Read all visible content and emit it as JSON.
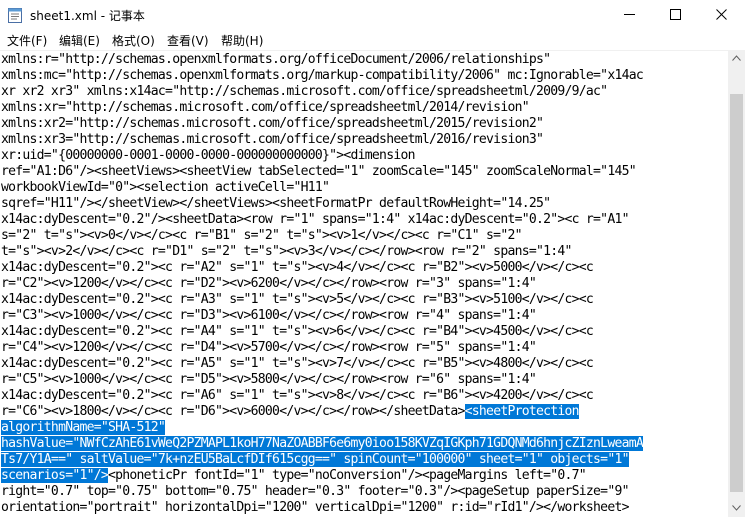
{
  "window": {
    "title": "sheet1.xml - 记事本",
    "controls": {
      "minimize": "minimize",
      "maximize": "maximize",
      "close": "close"
    }
  },
  "menu": {
    "items": [
      {
        "label": "文件(F)"
      },
      {
        "label": "编辑(E)"
      },
      {
        "label": "格式(O)"
      },
      {
        "label": "查看(V)"
      },
      {
        "label": "帮助(H)"
      }
    ]
  },
  "editor": {
    "lines": [
      [
        {
          "t": "xmlns:r=\"http://schemas.openxmlformats.org/officeDocument/2006/relationships\""
        }
      ],
      [
        {
          "t": "xmlns:mc=\"http://schemas.openxmlformats.org/markup-compatibility/2006\" mc:Ignorable=\"x14ac"
        }
      ],
      [
        {
          "t": "xr xr2 xr3\" xmlns:x14ac=\"http://schemas.microsoft.com/office/spreadsheetml/2009/9/ac\""
        }
      ],
      [
        {
          "t": "xmlns:xr=\"http://schemas.microsoft.com/office/spreadsheetml/2014/revision\""
        }
      ],
      [
        {
          "t": "xmlns:xr2=\"http://schemas.microsoft.com/office/spreadsheetml/2015/revision2\""
        }
      ],
      [
        {
          "t": "xmlns:xr3=\"http://schemas.microsoft.com/office/spreadsheetml/2016/revision3\""
        }
      ],
      [
        {
          "t": "xr:uid=\"{00000000-0001-0000-0000-000000000000}\"><dimension"
        }
      ],
      [
        {
          "t": "ref=\"A1:D6\"/><sheetViews><sheetView tabSelected=\"1\" zoomScale=\"145\" zoomScaleNormal=\"145\""
        }
      ],
      [
        {
          "t": "workbookViewId=\"0\"><selection activeCell=\"H11\""
        }
      ],
      [
        {
          "t": "sqref=\"H11\"/></sheetView></sheetViews><sheetFormatPr defaultRowHeight=\"14.25\""
        }
      ],
      [
        {
          "t": "x14ac:dyDescent=\"0.2\"/><sheetData><row r=\"1\" spans=\"1:4\" x14ac:dyDescent=\"0.2\"><c r=\"A1\""
        }
      ],
      [
        {
          "t": "s=\"2\" t=\"s\"><v>0</v></c><c r=\"B1\" s=\"2\" t=\"s\"><v>1</v></c><c r=\"C1\" s=\"2\""
        }
      ],
      [
        {
          "t": "t=\"s\"><v>2</v></c><c r=\"D1\" s=\"2\" t=\"s\"><v>3</v></c></row><row r=\"2\" spans=\"1:4\""
        }
      ],
      [
        {
          "t": "x14ac:dyDescent=\"0.2\"><c r=\"A2\" s=\"1\" t=\"s\"><v>4</v></c><c r=\"B2\"><v>5000</v></c><c"
        }
      ],
      [
        {
          "t": "r=\"C2\"><v>1200</v></c><c r=\"D2\"><v>6200</v></c></row><row r=\"3\" spans=\"1:4\""
        }
      ],
      [
        {
          "t": "x14ac:dyDescent=\"0.2\"><c r=\"A3\" s=\"1\" t=\"s\"><v>5</v></c><c r=\"B3\"><v>5100</v></c><c"
        }
      ],
      [
        {
          "t": "r=\"C3\"><v>1000</v></c><c r=\"D3\"><v>6100</v></c></row><row r=\"4\" spans=\"1:4\""
        }
      ],
      [
        {
          "t": "x14ac:dyDescent=\"0.2\"><c r=\"A4\" s=\"1\" t=\"s\"><v>6</v></c><c r=\"B4\"><v>4500</v></c><c"
        }
      ],
      [
        {
          "t": "r=\"C4\"><v>1200</v></c><c r=\"D4\"><v>5700</v></c></row><row r=\"5\" spans=\"1:4\""
        }
      ],
      [
        {
          "t": "x14ac:dyDescent=\"0.2\"><c r=\"A5\" s=\"1\" t=\"s\"><v>7</v></c><c r=\"B5\"><v>4800</v></c><c"
        }
      ],
      [
        {
          "t": "r=\"C5\"><v>1000</v></c><c r=\"D5\"><v>5800</v></c></row><row r=\"6\" spans=\"1:4\""
        }
      ],
      [
        {
          "t": "x14ac:dyDescent=\"0.2\"><c r=\"A6\" s=\"1\" t=\"s\"><v>8</v></c><c r=\"B6\"><v>4200</v></c><c"
        }
      ],
      [
        {
          "t": "r=\"C6\"><v>1800</v></c><c r=\"D6\"><v>6000</v></c></row></sheetData>"
        },
        {
          "t": "<sheetProtection",
          "hl": true
        }
      ],
      [
        {
          "t": "algorithmName=\"SHA-512\"",
          "hl": true
        }
      ],
      [
        {
          "t": "hashValue=\"NWfCzAhE61vWeQ2PZMAPL1koH77NaZOABBF6e6my0ioo158KVZqIGKph71GDQNMd6hnjcZIznLweamA",
          "hl": true
        }
      ],
      [
        {
          "t": "Ts7/Y1A==\" saltValue=\"7k+nzEU5BaLcfDIf615cgg==\" spinCount=\"100000\" sheet=\"1\" objects=\"1\"",
          "hl": true
        }
      ],
      [
        {
          "t": "scenarios=\"1\"/>",
          "hl": true
        },
        {
          "t": "<phoneticPr fontId=\"1\" type=\"noConversion\"/><pageMargins left=\"0.7\""
        }
      ],
      [
        {
          "t": "right=\"0.7\" top=\"0.75\" bottom=\"0.75\" header=\"0.3\" footer=\"0.3\"/><pageSetup paperSize=\"9\""
        }
      ],
      [
        {
          "t": "orientation=\"portrait\" horizontalDpi=\"1200\" verticalDpi=\"1200\" r:id=\"rId1\"/></worksheet>"
        }
      ]
    ]
  },
  "colors": {
    "selection": "#0078d7",
    "scrollbar_track": "#f0f0f0",
    "scrollbar_thumb": "#cdcdcd"
  }
}
